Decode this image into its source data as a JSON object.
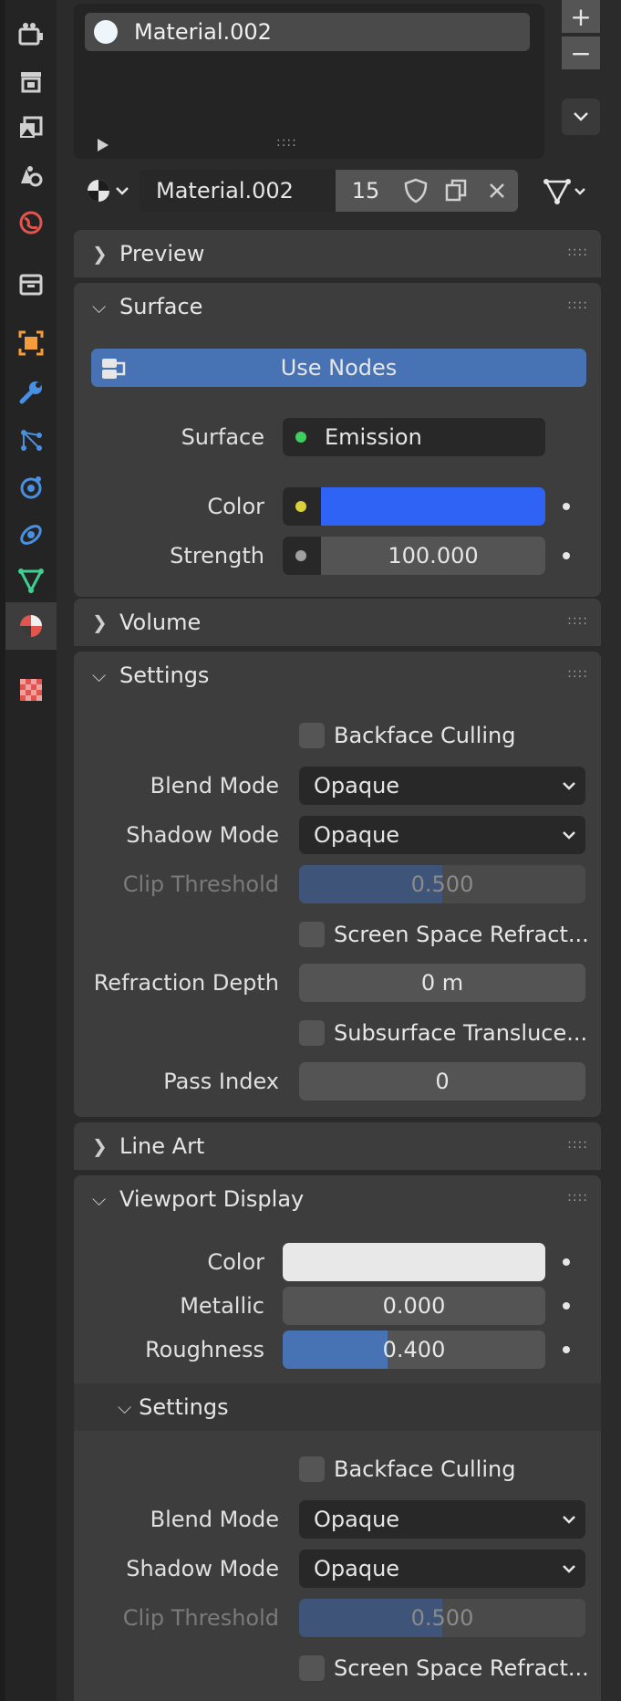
{
  "tabs": [
    {
      "name": "render-icon",
      "color": "#d0d0d0"
    },
    {
      "name": "output-icon",
      "color": "#d0d0d0"
    },
    {
      "name": "view-layer-icon",
      "color": "#d0d0d0"
    },
    {
      "name": "scene-icon",
      "color": "#d0d0d0"
    },
    {
      "name": "world-icon",
      "color": "#e0564d"
    },
    {
      "name": "collection-icon",
      "color": "#d0d0d0"
    },
    {
      "name": "object-icon",
      "color": "#f39c3c"
    },
    {
      "name": "modifier-icon",
      "color": "#4a90e2"
    },
    {
      "name": "particles-icon",
      "color": "#4a90e2"
    },
    {
      "name": "physics-icon",
      "color": "#4a90e2"
    },
    {
      "name": "constraints-icon",
      "color": "#4a90e2"
    },
    {
      "name": "data-icon",
      "color": "#3fcf8e"
    },
    {
      "name": "material-icon",
      "color": "#e0564d"
    },
    {
      "name": "texture-icon",
      "color": "#e0564d"
    }
  ],
  "slots": {
    "item": "Material.002",
    "plus": "+",
    "minus": "−",
    "grip": "::::"
  },
  "datablock": {
    "name": "Material.002",
    "users": "15"
  },
  "panels": {
    "preview": {
      "title": "Preview"
    },
    "surface": {
      "title": "Surface",
      "use_nodes": "Use Nodes",
      "surface_label": "Surface",
      "surface_value": "Emission",
      "color_label": "Color",
      "color_value": "#2e63f5",
      "strength_label": "Strength",
      "strength_value": "100.000"
    },
    "volume": {
      "title": "Volume"
    },
    "settings": {
      "title": "Settings",
      "backface": "Backface Culling",
      "blend_label": "Blend Mode",
      "blend_value": "Opaque",
      "shadow_label": "Shadow Mode",
      "shadow_value": "Opaque",
      "clip_label": "Clip Threshold",
      "clip_value": "0.500",
      "clip_fill": 0.5,
      "ssr": "Screen Space Refract...",
      "refraction_label": "Refraction Depth",
      "refraction_value": "0 m",
      "subsurface": "Subsurface Transluce...",
      "pass_label": "Pass Index",
      "pass_value": "0"
    },
    "lineart": {
      "title": "Line Art"
    },
    "viewport": {
      "title": "Viewport Display",
      "color_label": "Color",
      "color_value": "#e8e8e8",
      "metallic_label": "Metallic",
      "metallic_value": "0.000",
      "roughness_label": "Roughness",
      "roughness_value": "0.400",
      "roughness_fill": 0.4,
      "sub_title": "Settings",
      "backface": "Backface Culling",
      "blend_label": "Blend Mode",
      "blend_value": "Opaque",
      "shadow_label": "Shadow Mode",
      "shadow_value": "Opaque",
      "clip_label": "Clip Threshold",
      "clip_value": "0.500",
      "clip_fill": 0.5,
      "ssr": "Screen Space Refract..."
    }
  },
  "colors": {
    "accent": "#4772b3",
    "panel": "#3d3d3d",
    "field": "#545454",
    "dark_field": "#282828"
  }
}
